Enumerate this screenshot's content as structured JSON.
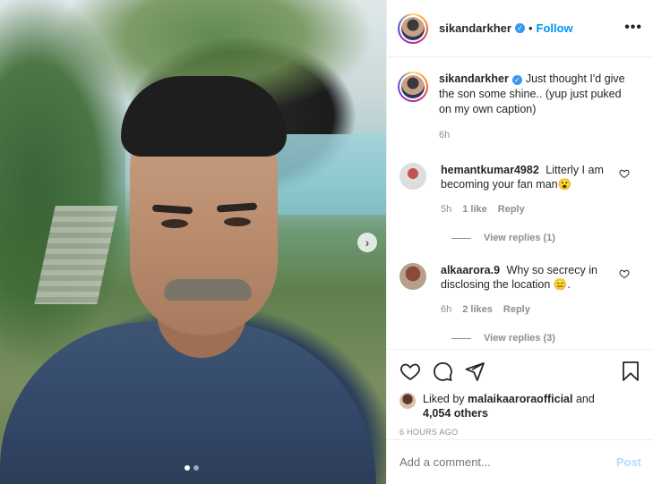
{
  "post": {
    "username": "sikandarkher",
    "follow_label": "Follow",
    "separator": "•",
    "more_label": "•••",
    "carousel_next": "›"
  },
  "caption": {
    "username": "sikandarkher",
    "text": "Just thought I'd give the son some shine.. (yup just puked on my own caption)",
    "time": "6h"
  },
  "comments": [
    {
      "username": "hemantkumar4982",
      "text": "Litterly I am becoming your fan man😮",
      "time": "5h",
      "likes": "1 like",
      "reply_label": "Reply",
      "view_replies": "View replies (1)"
    },
    {
      "username": "alkaarora.9",
      "text": "Why so secrecy in disclosing the location 😑.",
      "time": "6h",
      "likes": "2 likes",
      "reply_label": "Reply",
      "view_replies": "View replies (3)"
    }
  ],
  "likes": {
    "prefix": "Liked by",
    "liker": "malaikaaroraofficial",
    "and": "and",
    "others": "4,054 others"
  },
  "time_ago": "6 HOURS AGO",
  "add_comment": {
    "placeholder": "Add a comment...",
    "post_label": "Post"
  },
  "icons": [
    "heart-icon",
    "comment-icon",
    "share-icon",
    "bookmark-icon",
    "verified-icon",
    "more-icon"
  ],
  "colors": {
    "follow": "#0095f6",
    "post_disabled": "#b3dbff",
    "secondary_text": "#8e8e8e",
    "verified": "#3897f0"
  }
}
